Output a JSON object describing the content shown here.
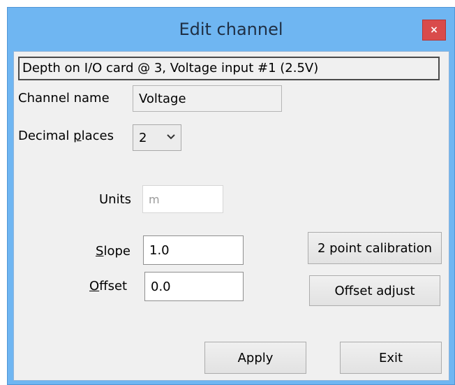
{
  "window": {
    "title": "Edit channel",
    "close_glyph": "×"
  },
  "channel_description": "Depth on I/O card @ 3, Voltage input #1 (2.5V)",
  "channel_name": {
    "label": "Channel name",
    "value": "Voltage"
  },
  "decimal_places": {
    "label_pre": "Decimal ",
    "label_mnemonic": "p",
    "label_post": "laces",
    "value": "2"
  },
  "units": {
    "label": "Units",
    "value": "m"
  },
  "slope": {
    "label_mnemonic": "S",
    "label_rest": "lope",
    "value": "1.0"
  },
  "offset": {
    "label_mnemonic": "O",
    "label_rest": "ffset",
    "value": "0.0"
  },
  "buttons": {
    "two_point_calibration": "2 point calibration",
    "offset_adjust": "Offset adjust",
    "apply": "Apply",
    "exit": "Exit"
  },
  "icons": {
    "close": "close-icon",
    "dropdown": "chevron-down-icon"
  },
  "colors": {
    "title_bar": "#6fb6f2",
    "close_button": "#d94b4b",
    "client_bg": "#f0f0f0"
  }
}
